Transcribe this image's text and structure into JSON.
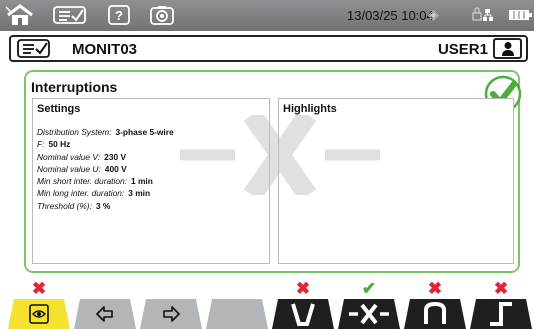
{
  "status_bar": {
    "datetime": "13/03/25 10:04",
    "icons": [
      "home-icon",
      "checklist-icon",
      "help-icon",
      "camera-icon",
      "sync-icon",
      "lock-icon",
      "network-icon",
      "battery-icon"
    ]
  },
  "header": {
    "title": "MONIT03",
    "user": "USER1",
    "icons": [
      "checklist-icon",
      "user-icon"
    ]
  },
  "panel": {
    "title": "Interruptions",
    "status": "ok",
    "accent_color": "#7cc46a",
    "settings": {
      "title": "Settings",
      "items": [
        {
          "label": "Distribution System:",
          "value": "3-phase 5-wire"
        },
        {
          "label": "F:",
          "value": "50 Hz"
        },
        {
          "label": "Nominal value V:",
          "value": "230 V"
        },
        {
          "label": "Nominal value U:",
          "value": "400 V"
        },
        {
          "label": "Min short inter. duration:",
          "value": "1 min"
        },
        {
          "label": "Min long inter. duration:",
          "value": "3 min"
        },
        {
          "label": "Threshold (%):",
          "value": "3 %"
        }
      ]
    },
    "highlights": {
      "title": "Highlights"
    }
  },
  "function_bar": {
    "keys": [
      {
        "name": "view",
        "icon": "eye-icon",
        "status": "error",
        "active": true
      },
      {
        "name": "previous",
        "icon": "arrow-left-icon",
        "status": null,
        "active": false
      },
      {
        "name": "next",
        "icon": "arrow-right-icon",
        "status": null,
        "active": false
      },
      {
        "name": "blank",
        "icon": null,
        "status": null,
        "active": false
      },
      {
        "name": "dip",
        "icon": "dip-icon",
        "status": "error",
        "active": false
      },
      {
        "name": "interruption",
        "icon": "interruption-icon",
        "status": "ok",
        "active": false
      },
      {
        "name": "swell",
        "icon": "swell-icon",
        "status": "error",
        "active": false
      },
      {
        "name": "transient",
        "icon": "transient-icon",
        "status": "error",
        "active": false
      }
    ],
    "colors": {
      "error": "#e0243a",
      "ok": "#4cad3a",
      "active": "#f5e22c"
    }
  }
}
